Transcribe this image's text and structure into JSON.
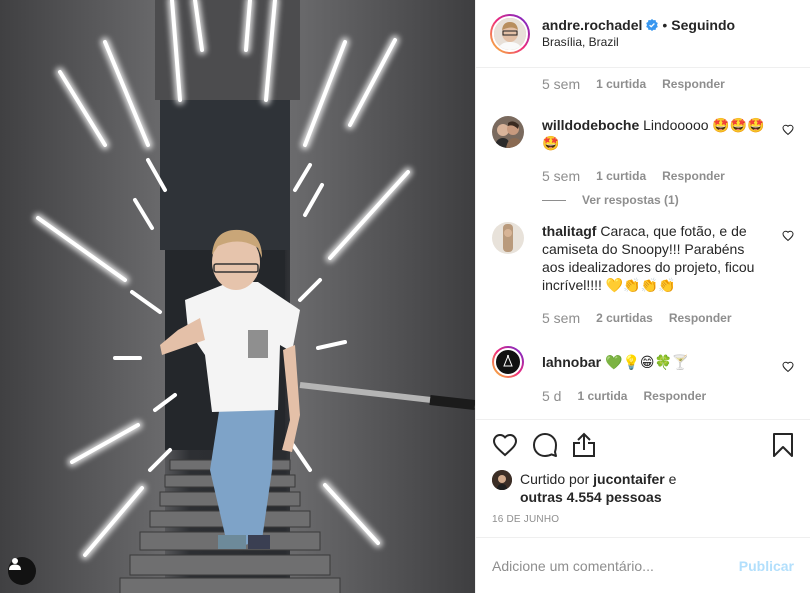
{
  "post": {
    "username": "andre.rochadel",
    "follow_label": "Seguindo",
    "separator": "•",
    "location": "Brasília, Brazil"
  },
  "comments": {
    "top_meta": {
      "time": "5 sem",
      "likes": "1 curtida",
      "reply": "Responder"
    },
    "items": [
      {
        "user": "willdodeboche",
        "text": "Lindooooo 🤩🤩🤩🤩",
        "time": "5 sem",
        "likes": "1 curtida",
        "reply": "Responder",
        "view_replies": "Ver respostas (1)"
      },
      {
        "user": "thalitagf",
        "text": "Caraca, que fotão, e de camiseta do Snoopy!!! Parabéns aos idealizadores do projeto, ficou incrível!!!! 💛👏👏👏",
        "time": "5 sem",
        "likes": "2 curtidas",
        "reply": "Responder"
      },
      {
        "user": "lahnobar",
        "text": "💚💡😁🍀🍸",
        "time": "5 d",
        "likes": "1 curtida",
        "reply": "Responder"
      }
    ]
  },
  "likes": {
    "prefix": "Curtido por",
    "user": "jucontaifer",
    "and": "e",
    "others": "outras 4.554 pessoas"
  },
  "date": "16 DE JUNHO",
  "add_comment": {
    "placeholder": "Adicione um comentário...",
    "publish": "Publicar"
  },
  "icons": {
    "like": "heart-icon",
    "comment": "comment-icon",
    "share": "share-icon",
    "save": "bookmark-icon",
    "verified": "verified-badge-icon",
    "user_tag": "user-tag-icon"
  },
  "colors": {
    "verified": "#3897f0",
    "publish_disabled": "#b2dffc",
    "muted": "#8e8e8e",
    "text": "#262626"
  }
}
